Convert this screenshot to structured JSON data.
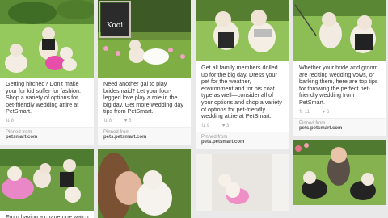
{
  "pins": [
    {
      "description": "Getting hitched? Don't make your fur kid suffer for fashion. Shop a variety of options for pet-friendly wedding attire at PetSmart.",
      "repins": "8",
      "likes": "",
      "source_label": "Pinned from",
      "source": "petsmart.com",
      "image_label": "dogs in wedding attire on lawn"
    },
    {
      "description": "Need another gal to play bridesmaid? Let your four-legged love play a role in the big day. Get more wedding day tips from PetSmart.",
      "repins": "8",
      "likes": "5",
      "source_label": "Pinned from",
      "source": "pets.petsmart.com",
      "image_label": "dog in white dress under chalkboard sign",
      "sign_text": "Kooi"
    },
    {
      "description": "Get all family members dolled up for the big day. Dress your pet for the weather, environment and for his coat type as well—consider all of your options and shop a variety of options for pet-friendly wedding attire at PetSmart.",
      "repins": "9",
      "likes": "3",
      "source_label": "Pinned from",
      "source": "pets.petsmart.com",
      "image_label": "two dogs in tux and dress"
    },
    {
      "description": "Whether your bride and groom are reciting wedding vows, or barking them, here are top tips for throwing the perfect pet-friendly wedding from PetSmart.",
      "repins": "11",
      "likes": "6",
      "source_label": "Pinned from",
      "source": "pets.petsmart.com",
      "image_label": "dog bride and groom on grass"
    }
  ],
  "bottom_pins": [
    {
      "description": "From having a chaperone watch",
      "image_label": "dogs in pink dresses on grass"
    },
    {
      "image_label": "girl kissing white dog"
    },
    {
      "image_label": "white dog in pink tutu"
    },
    {
      "image_label": "child with dogs in tuxedos"
    }
  ]
}
